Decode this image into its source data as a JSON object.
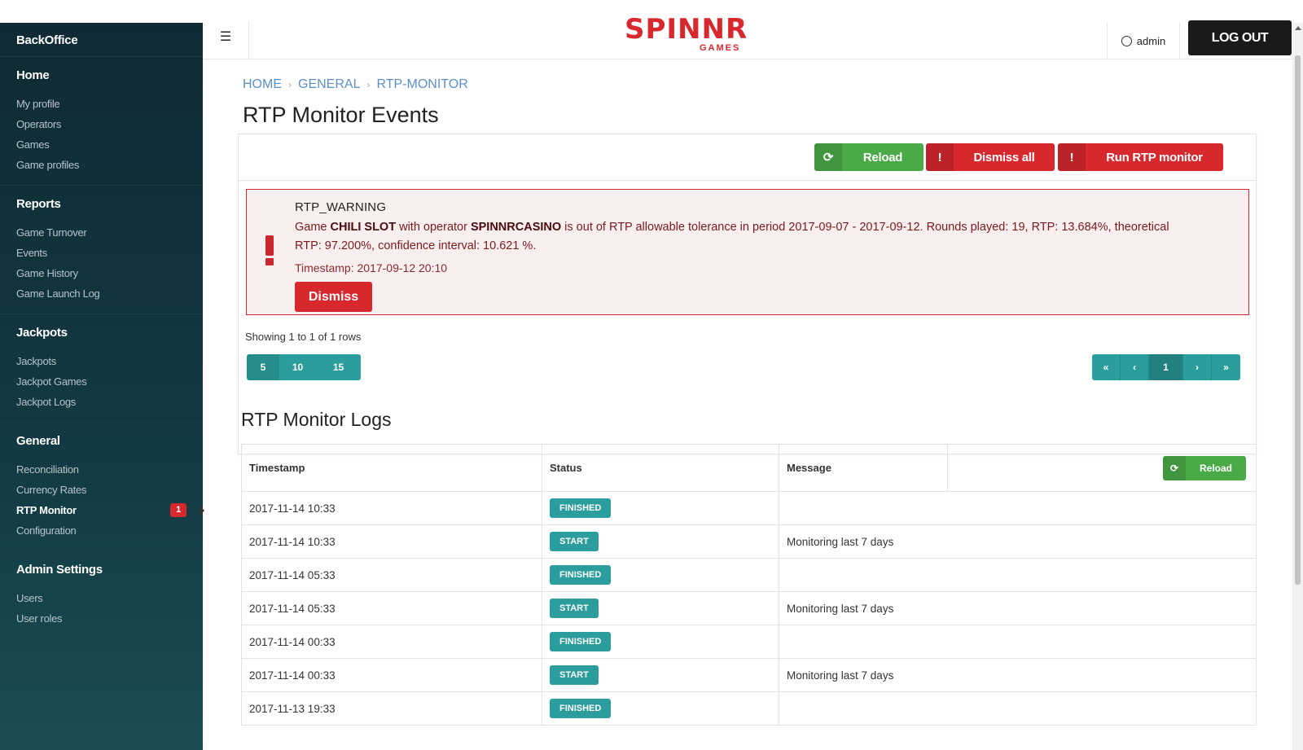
{
  "sidebar": {
    "brand": "BackOffice",
    "sections": [
      {
        "title": "Home",
        "items": [
          "My profile",
          "Operators",
          "Games",
          "Game profiles"
        ]
      },
      {
        "title": "Reports",
        "items": [
          "Game Turnover",
          "Events",
          "Game History",
          "Game Launch Log"
        ]
      },
      {
        "title": "Jackpots",
        "items": [
          "Jackpots",
          "Jackpot Games",
          "Jackpot Logs"
        ]
      },
      {
        "title": "General",
        "items": [
          "Reconciliation",
          "Currency Rates",
          "RTP Monitor",
          "Configuration"
        ]
      },
      {
        "title": "Admin Settings",
        "items": [
          "Users",
          "User roles"
        ]
      }
    ],
    "rtp_badge": "1"
  },
  "topbar": {
    "logo_main": "SPINNR",
    "logo_sub": "GAMES",
    "user": "admin",
    "logout": "LOG OUT"
  },
  "breadcrumb": [
    "HOME",
    "GENERAL",
    "RTP-MONITOR"
  ],
  "page_title": "RTP Monitor Events",
  "toolbar": {
    "reload": "Reload",
    "dismiss_all": "Dismiss all",
    "run_monitor": "Run RTP monitor"
  },
  "alert": {
    "type": "RTP_WARNING",
    "msg_prefix": "Game ",
    "game": "CHILI SLOT",
    "msg_mid": " with operator ",
    "operator": "SPINNRCASINO",
    "msg_suffix": " is out of RTP allowable tolerance in period 2017-09-07 - 2017-09-12. Rounds played: 19, RTP: 13.684%, theoretical RTP: 97.200%, confidence interval: 10.621 %.",
    "timestamp": "Timestamp: 2017-09-12 20:10",
    "dismiss": "Dismiss"
  },
  "rows_info": "Showing 1 to 1 of 1 rows",
  "page_sizes": [
    "5",
    "10",
    "15"
  ],
  "pager": [
    "«",
    "‹",
    "1",
    "›",
    "»"
  ],
  "logs": {
    "title": "RTP Monitor Logs",
    "headers": [
      "Timestamp",
      "Status",
      "Message"
    ],
    "reload": "Reload",
    "rows": [
      {
        "ts": "2017-11-14 10:33",
        "status": "FINISHED",
        "msg": ""
      },
      {
        "ts": "2017-11-14 10:33",
        "status": "START",
        "msg": "Monitoring last 7 days"
      },
      {
        "ts": "2017-11-14 05:33",
        "status": "FINISHED",
        "msg": ""
      },
      {
        "ts": "2017-11-14 05:33",
        "status": "START",
        "msg": "Monitoring last 7 days"
      },
      {
        "ts": "2017-11-14 00:33",
        "status": "FINISHED",
        "msg": ""
      },
      {
        "ts": "2017-11-14 00:33",
        "status": "START",
        "msg": "Monitoring last 7 days"
      },
      {
        "ts": "2017-11-13 19:33",
        "status": "FINISHED",
        "msg": ""
      }
    ]
  },
  "colors": {
    "brand_red": "#d7282e",
    "success_green": "#4aaa47",
    "teal": "#2a9d9c",
    "sidebar_dark": "#0f2a33"
  }
}
